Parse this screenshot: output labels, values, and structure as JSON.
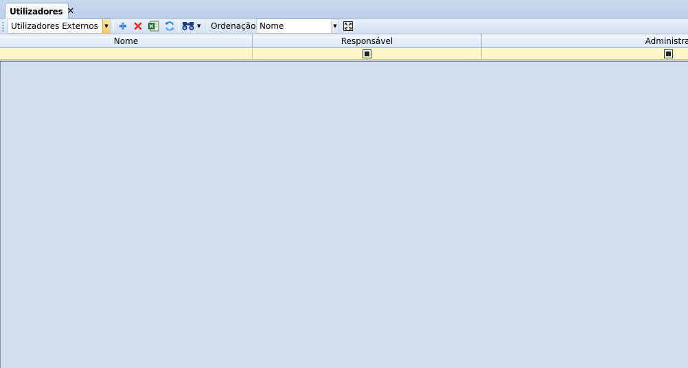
{
  "tabs": [
    {
      "label": "Utilizadores",
      "close": "✕"
    }
  ],
  "toolbar": {
    "filter_value": "Utilizadores Externos",
    "order_label": "Ordenação:",
    "order_value": "Nome",
    "icons": [
      "add-icon",
      "delete-icon",
      "excel-export-icon",
      "refresh-icon",
      "binoculars-icon",
      "fit-columns-icon"
    ]
  },
  "grid": {
    "columns": [
      "Nome",
      "Responsável",
      "Administrador"
    ],
    "filter_row": {
      "responsavel": "indeterminate",
      "administrador": "indeterminate"
    },
    "rows": []
  },
  "colors": {
    "background": "#d0deef",
    "filter_row": "#fff8c6",
    "delete": "#e8231c",
    "add": "#2a6fd6"
  }
}
